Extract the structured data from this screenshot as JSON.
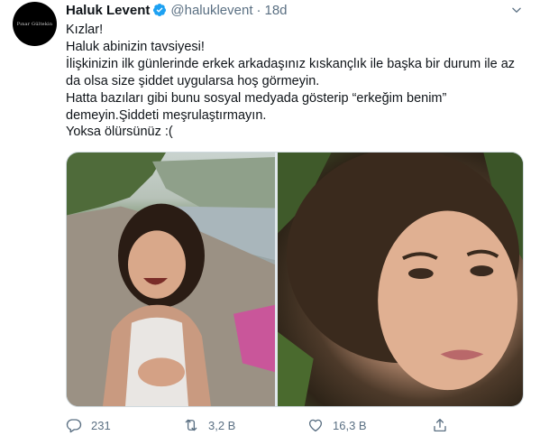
{
  "tweet": {
    "author_name": "Haluk Levent",
    "handle": "@haluklevent",
    "separator": "·",
    "time": "18d",
    "avatar_text": "Pınar Gültekin",
    "text_lines": [
      "Kızlar!",
      "Haluk abinizin tavsiyesi!",
      "İlişkinizin ilk günlerinde erkek arkadaşınız kıskançlık ile başka bir durum ile az da olsa size şiddet uygularsa hoş görmeyin.",
      "Hatta bazıları gibi bunu sosyal medyada gösterip “erkeğim benim” demeyin.Şiddeti meşrulaştırmayın.",
      "Yoksa ölürsünüz :("
    ]
  },
  "actions": {
    "reply_count": "231",
    "retweet_count": "3,2 B",
    "like_count": "16,3 B"
  },
  "icons": {
    "verified": "verified-badge-icon",
    "more": "chevron-down-icon",
    "reply": "reply-icon",
    "retweet": "retweet-icon",
    "like": "heart-icon",
    "share": "share-icon"
  },
  "colors": {
    "text": "#0f1419",
    "secondary": "#5b7083",
    "verified": "#1da1f2",
    "border": "#cfd9de"
  }
}
